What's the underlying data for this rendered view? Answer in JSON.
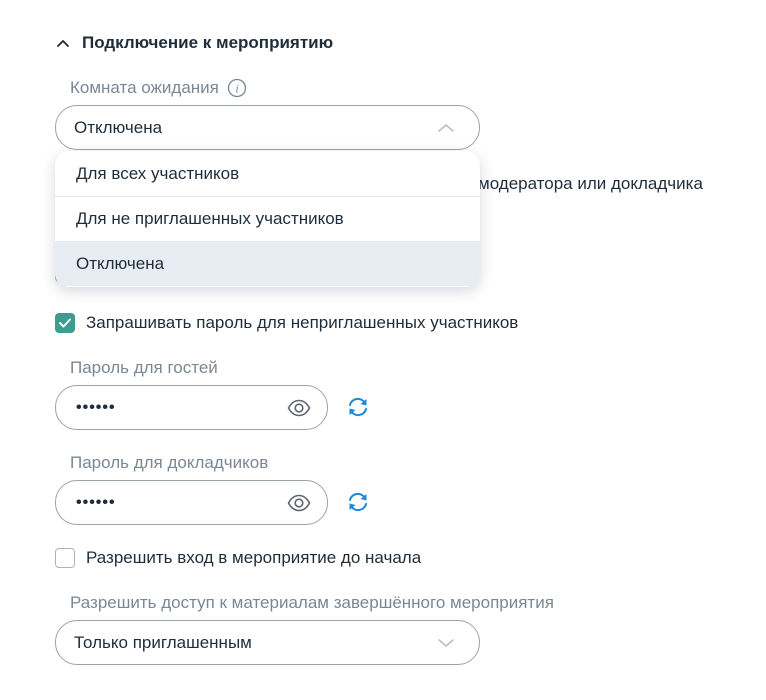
{
  "section": {
    "title": "Подключение к мероприятию",
    "expanded": true
  },
  "waiting_room": {
    "label": "Комната ожидания",
    "value": "Отключена",
    "options": [
      "Для всех участников",
      "Для не приглашенных участников",
      "Отключена"
    ],
    "selected_index": 2
  },
  "obscured_option_text": "модератора или докладчика",
  "ask_password": {
    "label": "Запрашивать пароль для неприглашенных участников",
    "checked": true
  },
  "guest_password": {
    "label": "Пароль для гостей",
    "value": "••••••"
  },
  "speaker_password": {
    "label": "Пароль для докладчиков",
    "value": "••••••"
  },
  "early_entry": {
    "label": "Разрешить вход в мероприятие до начала",
    "checked": false
  },
  "materials_access": {
    "label": "Разрешить доступ к материалам завершённого мероприятия",
    "value": "Только приглашенным"
  },
  "colors": {
    "accent": "#3d9b8f",
    "refresh_icon": "#1e88d6",
    "border": "#9aa3ad",
    "label": "#7b8794",
    "text": "#1f2d3a",
    "selected_option_bg": "#e8edf3"
  }
}
